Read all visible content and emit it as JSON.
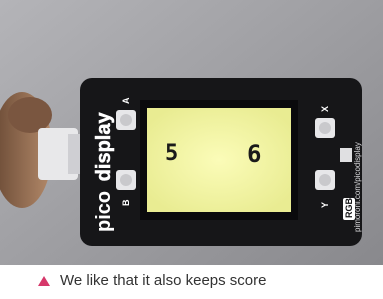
{
  "caption": {
    "text": "We like that it also keeps score",
    "marker_color": "#d6386a"
  },
  "device": {
    "brand_left": "pico",
    "brand_right": "display",
    "url": "pimoroni.com/picodisplay",
    "led_label": "RGB",
    "buttons": {
      "a": "A",
      "b": "B",
      "x": "X",
      "y": "Y"
    },
    "screen_color": "#f4f6a6"
  },
  "game": {
    "score_left": "5",
    "score_right": "6"
  }
}
